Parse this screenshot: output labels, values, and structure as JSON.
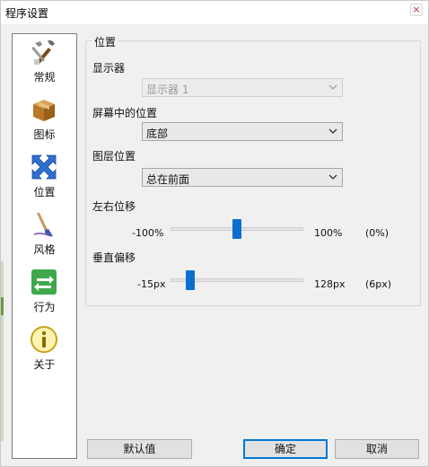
{
  "window": {
    "title": "程序设置",
    "close_glyph": "×"
  },
  "sidebar": {
    "items": [
      {
        "label": "常规",
        "icon": "tools-icon",
        "selected": false
      },
      {
        "label": "图标",
        "icon": "package-icon",
        "selected": false
      },
      {
        "label": "位置",
        "icon": "move-arrows-icon",
        "selected": true
      },
      {
        "label": "风格",
        "icon": "paintbrush-icon",
        "selected": false
      },
      {
        "label": "行为",
        "icon": "swap-arrows-icon",
        "selected": false
      },
      {
        "label": "关于",
        "icon": "info-icon",
        "selected": false
      }
    ]
  },
  "position": {
    "group_title": "位置",
    "monitor": {
      "label": "显示器",
      "value": "显示器 1",
      "disabled": true
    },
    "screen_position": {
      "label": "屏幕中的位置",
      "value": "底部"
    },
    "layer": {
      "label": "图层位置",
      "value": "总在前面"
    },
    "horizontal_offset": {
      "label": "左右位移",
      "min": "-100%",
      "max": "100%",
      "current": "(0%)",
      "value_fraction": 0.5
    },
    "vertical_offset": {
      "label": "垂直偏移",
      "min": "-15px",
      "max": "128px",
      "current": "(6px)",
      "value_fraction": 0.15
    }
  },
  "footer": {
    "defaults_label": "默认值",
    "ok_label": "确定",
    "cancel_label": "取消"
  },
  "colors": {
    "accent": "#0a6fd0",
    "window_bg": "#f0f0f0"
  }
}
